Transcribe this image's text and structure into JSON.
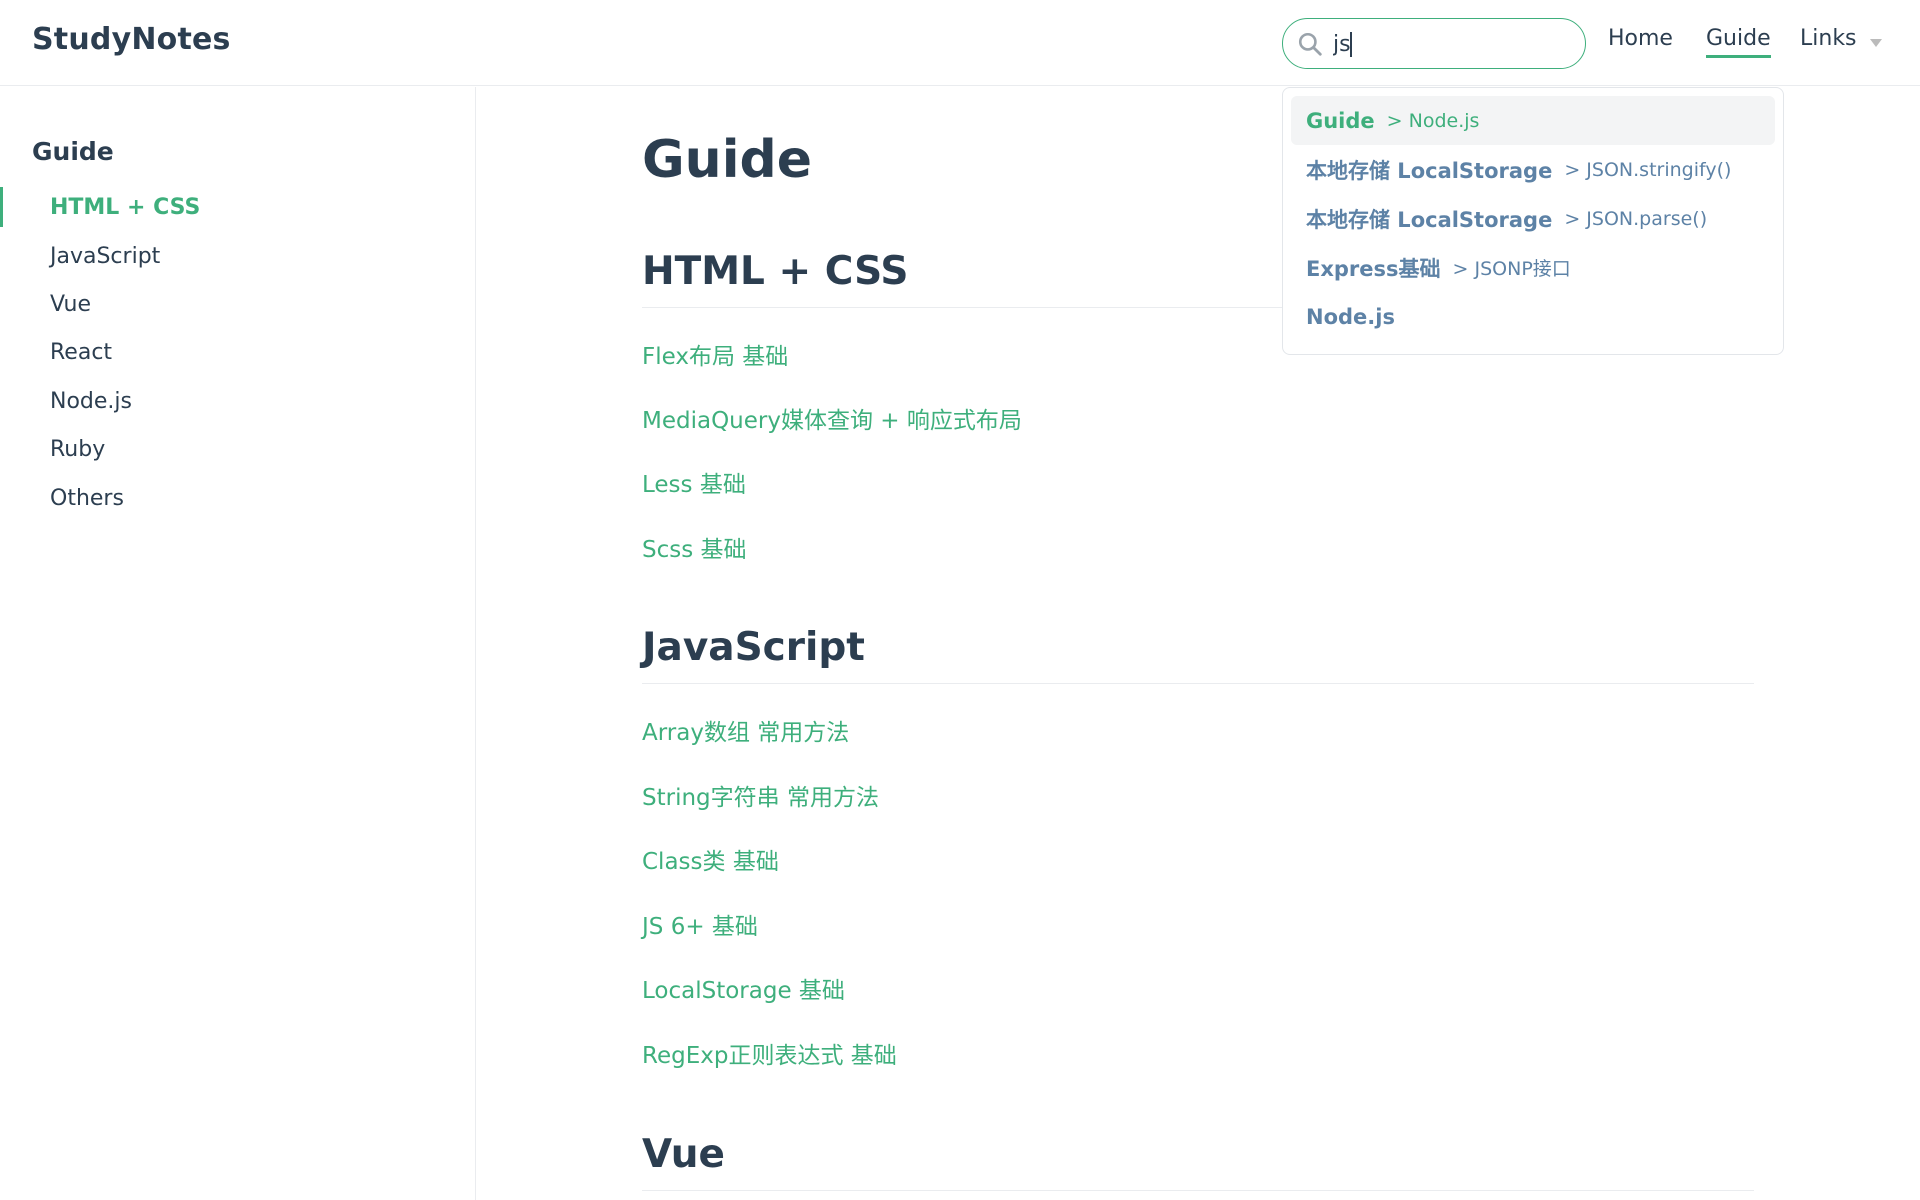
{
  "site": {
    "name": "StudyNotes"
  },
  "search": {
    "value": "js",
    "placeholder": ""
  },
  "nav": {
    "home": "Home",
    "guide": "Guide",
    "links": "Links"
  },
  "suggestions": [
    {
      "page": "Guide",
      "header": "> Node.js",
      "focused": true
    },
    {
      "page": "本地存储 LocalStorage",
      "header": "> JSON.stringify()"
    },
    {
      "page": "本地存储 LocalStorage",
      "header": "> JSON.parse()"
    },
    {
      "page": "Express基础",
      "header": "> JSONP接口"
    },
    {
      "page": "Node.js",
      "header": ""
    }
  ],
  "sidebar": {
    "heading": "Guide",
    "items": [
      {
        "label": "HTML + CSS",
        "active": true
      },
      {
        "label": "JavaScript"
      },
      {
        "label": "Vue"
      },
      {
        "label": "React"
      },
      {
        "label": "Node.js"
      },
      {
        "label": "Ruby"
      },
      {
        "label": "Others"
      }
    ]
  },
  "main": {
    "title": "Guide",
    "sections": [
      {
        "heading": "HTML + CSS",
        "links": [
          "Flex布局 基础",
          "MediaQuery媒体查询 + 响应式布局",
          "Less 基础",
          "Scss 基础"
        ]
      },
      {
        "heading": "JavaScript",
        "links": [
          "Array数组 常用方法",
          "String字符串 常用方法",
          "Class类 基础",
          "JS 6+ 基础",
          "LocalStorage 基础",
          "RegExp正则表达式 基础"
        ]
      },
      {
        "heading": "Vue",
        "links": []
      }
    ]
  },
  "colors": {
    "accent": "#3eaf7c",
    "text": "#2c3e50",
    "suggestion_text": "#5d82a6",
    "border": "#eaecef"
  }
}
